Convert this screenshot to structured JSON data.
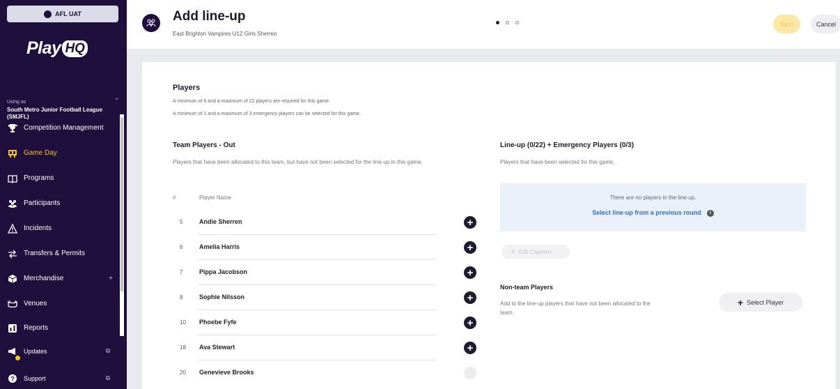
{
  "sidebar": {
    "env_label": "AFL UAT",
    "logo_text": "Play",
    "logo_hq": "HQ",
    "using_as_label": "Using as",
    "org_name": "South Metro Junior Football League (SMJFL)",
    "nav_items": [
      {
        "label": "Competition Management",
        "icon": "trophy-icon"
      },
      {
        "label": "Game Day",
        "icon": "scoreboard-icon"
      },
      {
        "label": "Programs",
        "icon": "book-icon"
      },
      {
        "label": "Participants",
        "icon": "people-icon"
      },
      {
        "label": "Incidents",
        "icon": "warning-icon"
      },
      {
        "label": "Transfers & Permits",
        "icon": "transfer-icon"
      },
      {
        "label": "Merchandise",
        "icon": "box-icon"
      },
      {
        "label": "Venues",
        "icon": "stadium-icon"
      },
      {
        "label": "Reports",
        "icon": "chart-icon"
      },
      {
        "label": "Updates",
        "icon": "megaphone-icon"
      },
      {
        "label": "Support",
        "icon": "help-icon"
      }
    ],
    "merch_plus": "+",
    "active_index": 1
  },
  "header": {
    "title": "Add line-up",
    "subtitle": "East Brighton Vampires U12 Girls Sherren",
    "next_label": "Next",
    "cancel_label": "Cancel",
    "steps_total": 3,
    "current_step": 1
  },
  "players": {
    "title": "Players",
    "note1": "A minimum of 6 and a maximum of 22 players are required for this game.",
    "note2": "A minimum of 1 and a maximum of 3 emergency players can be selected for this game."
  },
  "team_out": {
    "title": "Team Players - Out",
    "description": "Players that have been allocated to this team, but have not been selected for the line-up in this game.",
    "col_number": "#",
    "col_name": "Player Name",
    "rows": [
      {
        "number": "5",
        "name": "Andie Sherren",
        "enabled": true
      },
      {
        "number": "6",
        "name": "Amelia Harris",
        "enabled": true
      },
      {
        "number": "7",
        "name": "Pippa Jacobson",
        "enabled": true
      },
      {
        "number": "8",
        "name": "Sophie Nilsson",
        "enabled": true
      },
      {
        "number": "10",
        "name": "Phoebe Fyfe",
        "enabled": true
      },
      {
        "number": "18",
        "name": "Ava Stewart",
        "enabled": true
      },
      {
        "number": "20",
        "name": "Genevieve Brooks",
        "enabled": false
      }
    ]
  },
  "lineup": {
    "title": "Line-up (0/22) + Emergency Players (0/3)",
    "description": "Players that have been selected for this game.",
    "empty_text": "There are no players in the line-up.",
    "previous_round_link": "Select line-up from a previous round",
    "edit_captains_label": "Edit Captains"
  },
  "non_team": {
    "title": "Non-team Players",
    "description": "Add to the line-up players that have not been allocated to the team.",
    "select_player_label": "Select Player"
  },
  "colors": {
    "sidebar_bg": "#1f0f3d",
    "accent_yellow": "#f5c518",
    "link_blue": "#2f6fd0"
  }
}
